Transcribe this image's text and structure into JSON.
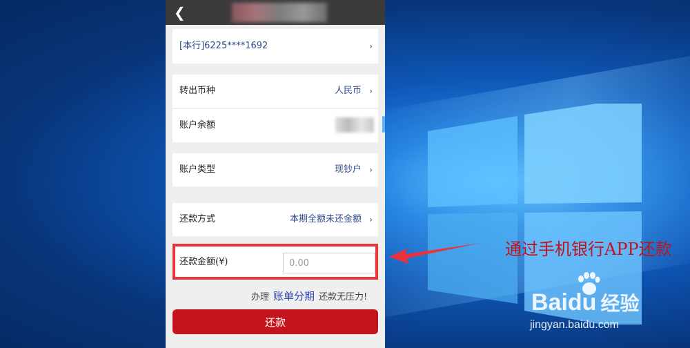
{
  "colors": {
    "topbar": "#3b3b3b",
    "value_text": "#2f4a8a",
    "button": "#c3141d",
    "highlight": "#e8333a",
    "annotation": "#c0141c",
    "link": "#2b45b4"
  },
  "header": {
    "back_icon": "chevron-left-icon"
  },
  "card": {
    "label": "[本行]6225****1692",
    "chevron": "›"
  },
  "currency": {
    "label": "转出币种",
    "value": "人民币",
    "chevron": "›"
  },
  "balance": {
    "label": "账户余额"
  },
  "account_type": {
    "label": "账户类型",
    "value": "现钞户",
    "chevron": "›"
  },
  "repay_method": {
    "label": "还款方式",
    "value": "本期全额未还金额",
    "chevron": "›"
  },
  "amount": {
    "label": "还款金额(¥)",
    "placeholder": "0.00"
  },
  "promo": {
    "prefix": "办理",
    "link": "账单分期",
    "suffix": "还款无压力!"
  },
  "submit": {
    "label": "还款"
  },
  "annotation": {
    "text": "通过手机银行APP还款"
  },
  "watermark": {
    "logo": "Baidu",
    "logo_cn": "经验",
    "url": "jingyan.baidu.com"
  }
}
